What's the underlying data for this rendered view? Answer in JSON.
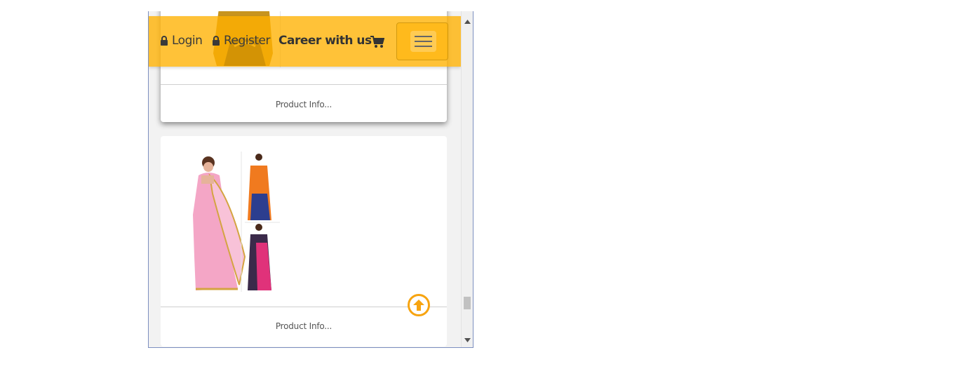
{
  "navbar": {
    "login_label": "Login",
    "register_label": "Register",
    "career_label": "Career with us",
    "icons": {
      "lock": "lock-icon",
      "cart": "shopping-cart-icon",
      "menu": "hamburger-menu-icon"
    },
    "background_color": "#ffb100"
  },
  "products": [
    {
      "info_label": "Product Info..."
    },
    {
      "info_label": "Product Info..."
    }
  ],
  "back_to_top": {
    "icon": "arrow-up-circle-icon",
    "color": "#f7a410"
  }
}
